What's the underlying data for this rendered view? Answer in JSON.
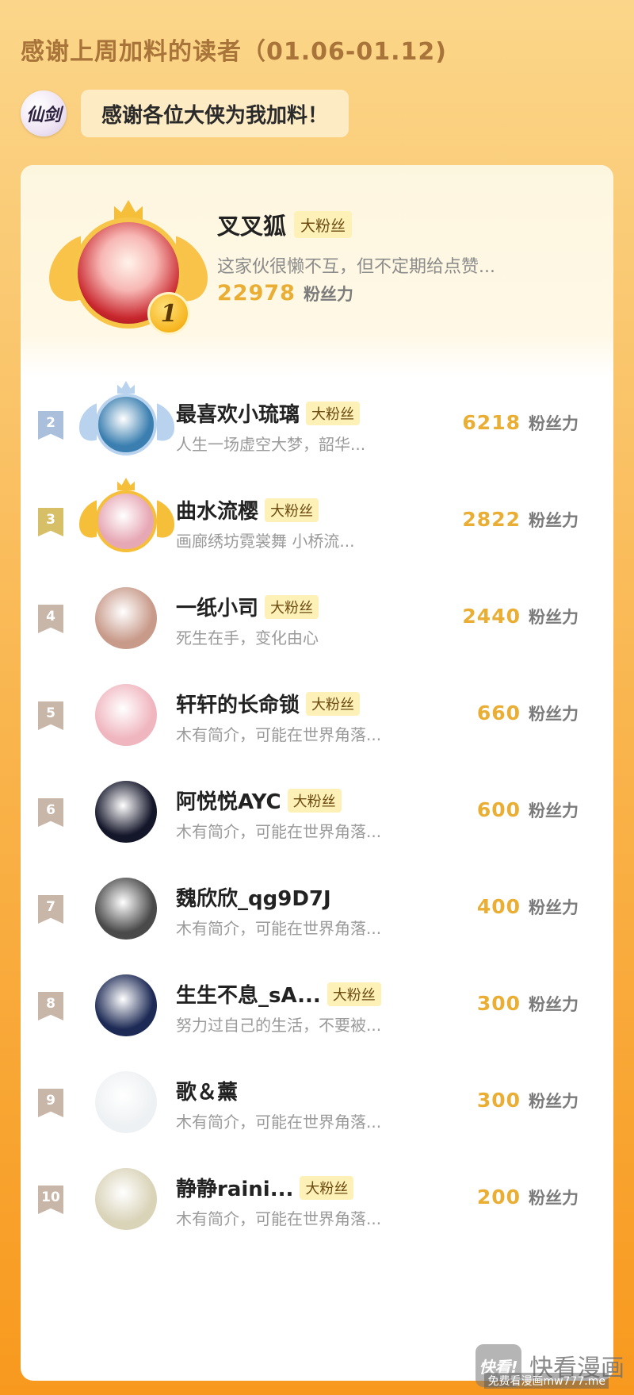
{
  "header": {
    "title": "感谢上周加料的读者（01.06-01.12)"
  },
  "speech": {
    "logo_text": "仙剑",
    "message": "感谢各位大侠为我加料！"
  },
  "unit_label": "粉丝力",
  "top_fan": {
    "rank": "1",
    "name": "叉叉狐",
    "badge": "大粉丝",
    "bio": "这家伙很懒不互，但不定期给点赞...",
    "score": "22978"
  },
  "rankings": [
    {
      "rank": "2",
      "name": "最喜欢小琉璃",
      "badge": "大粉丝",
      "bio": "人生一场虚空大梦，韶华...",
      "score": "6218",
      "ribbon_color": "#a9bfdc",
      "avatar_bg": "#3a7fb0",
      "frame": "silver"
    },
    {
      "rank": "3",
      "name": "曲水流樱",
      "badge": "大粉丝",
      "bio": "画廊绣坊霓裳舞 小桥流...",
      "score": "2822",
      "ribbon_color": "#d6bf66",
      "avatar_bg": "#e7a8b5",
      "frame": "gold"
    },
    {
      "rank": "4",
      "name": "一纸小司",
      "badge": "大粉丝",
      "bio": "死生在手，变化由心",
      "score": "2440",
      "ribbon_color": "#c8b6a8",
      "avatar_bg": "#c89a8a",
      "frame": ""
    },
    {
      "rank": "5",
      "name": "轩轩的长命锁",
      "badge": "大粉丝",
      "bio": "木有简介，可能在世界角落...",
      "score": "660",
      "ribbon_color": "#c8b6a8",
      "avatar_bg": "#f0b6bf",
      "frame": ""
    },
    {
      "rank": "6",
      "name": "阿悦悦AYC",
      "badge": "大粉丝",
      "bio": "木有简介，可能在世界角落...",
      "score": "600",
      "ribbon_color": "#c8b6a8",
      "avatar_bg": "#14162a",
      "frame": ""
    },
    {
      "rank": "7",
      "name": "魏欣欣_qg9D7J",
      "badge": "",
      "bio": "木有简介，可能在世界角落...",
      "score": "400",
      "ribbon_color": "#c8b6a8",
      "avatar_bg": "#4a4a4a",
      "frame": ""
    },
    {
      "rank": "8",
      "name": "生生不息_sA...",
      "badge": "大粉丝",
      "bio": "努力过自己的生活，不要被...",
      "score": "300",
      "ribbon_color": "#c8b6a8",
      "avatar_bg": "#1d2a55",
      "frame": ""
    },
    {
      "rank": "9",
      "name": "歌＆薰",
      "badge": "",
      "bio": "木有简介，可能在世界角落...",
      "score": "300",
      "ribbon_color": "#c8b6a8",
      "avatar_bg": "#eef1f3",
      "frame": ""
    },
    {
      "rank": "10",
      "name": "静静raini...",
      "badge": "大粉丝",
      "bio": "木有简介，可能在世界角落...",
      "score": "200",
      "ribbon_color": "#c8b6a8",
      "avatar_bg": "#d9d3b8",
      "frame": ""
    }
  ],
  "watermark": {
    "logo_text": "快看!",
    "brand": "快看漫画",
    "sub": "免费看漫画mw777.me"
  },
  "colors": {
    "gold": "#f6bf3a",
    "silver": "#b9d3ef",
    "score": "#e9ae33"
  }
}
